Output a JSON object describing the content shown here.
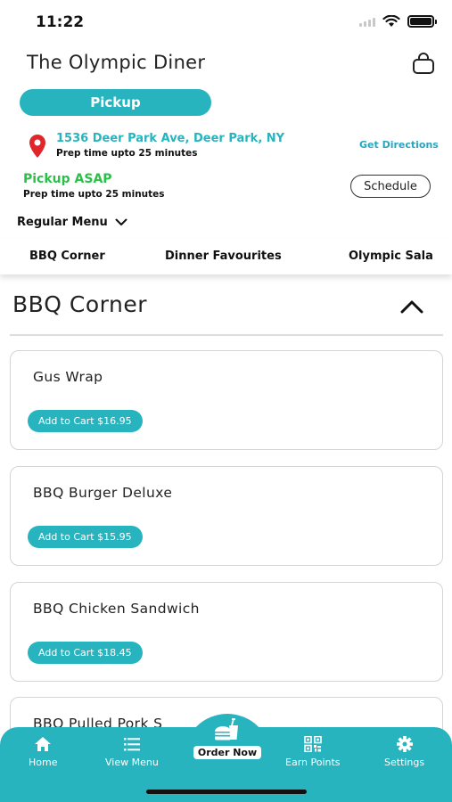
{
  "status_bar": {
    "time": "11:22"
  },
  "header": {
    "restaurant_name": "The Olympic Diner",
    "mode_label": "Pickup"
  },
  "location": {
    "address": "1536 Deer Park Ave, Deer Park, NY",
    "prep_time": "Prep time upto 25 minutes",
    "directions_label": "Get Directions"
  },
  "pickup": {
    "title": "Pickup ASAP",
    "prep_time": "Prep time upto 25 minutes",
    "schedule_label": "Schedule"
  },
  "menu_selector": {
    "selected": "Regular Menu"
  },
  "category_tabs": [
    "BBQ Corner",
    "Dinner Favourites",
    "Olympic Sala"
  ],
  "section": {
    "title": "BBQ Corner",
    "items": [
      {
        "name": "Gus Wrap",
        "cart_label": "Add to Cart $16.95"
      },
      {
        "name": "BBQ Burger Deluxe",
        "cart_label": "Add to Cart $15.95"
      },
      {
        "name": "BBQ Chicken Sandwich",
        "cart_label": "Add to Cart $18.45"
      },
      {
        "name": "BBQ Pulled Pork S"
      }
    ]
  },
  "bottom_nav": {
    "home": "Home",
    "view_menu": "View Menu",
    "order_now": "Order Now",
    "earn_points": "Earn Points",
    "settings": "Settings"
  },
  "colors": {
    "accent": "#27b4bf",
    "pickup_green": "#2bbf4a",
    "pin_red": "#e0262b"
  },
  "icons": [
    "bag-icon",
    "location-pin-icon",
    "chevron-down-icon",
    "chevron-up-icon",
    "home-icon",
    "list-icon",
    "burger-drink-icon",
    "qr-code-icon",
    "gear-icon"
  ]
}
